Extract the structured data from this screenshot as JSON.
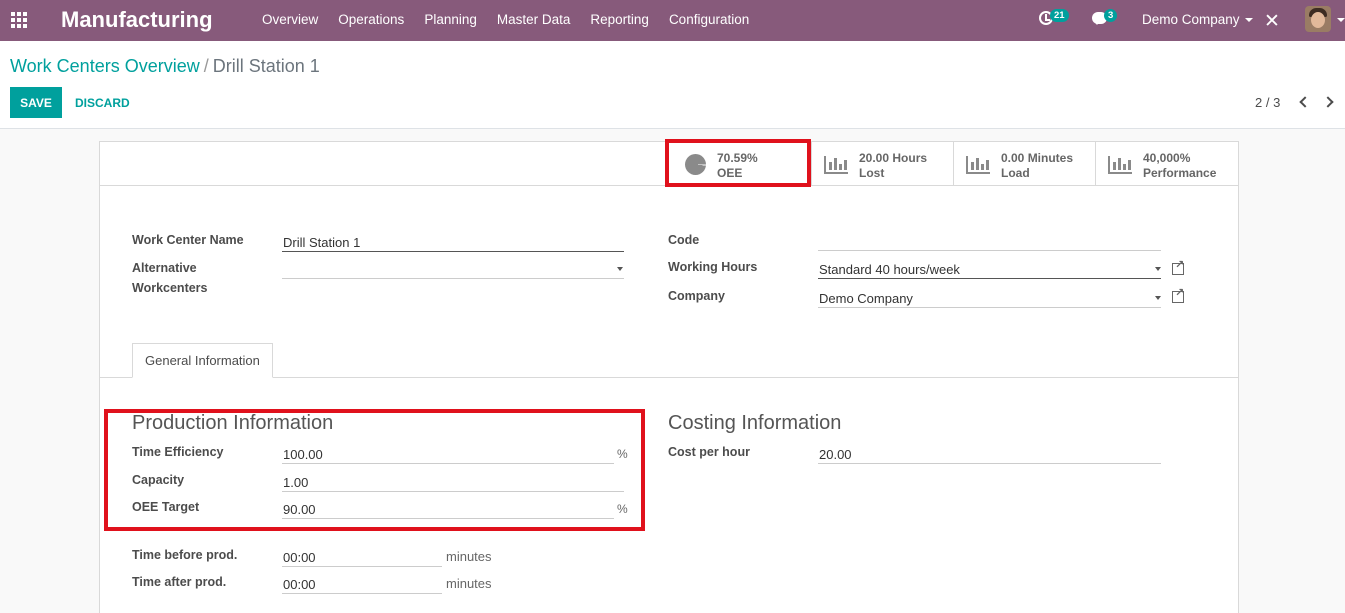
{
  "navbar": {
    "app_title": "Manufacturing",
    "menu": [
      "Overview",
      "Operations",
      "Planning",
      "Master Data",
      "Reporting",
      "Configuration"
    ],
    "activity_count": "21",
    "message_count": "3",
    "company": "Demo Company"
  },
  "breadcrumb": {
    "parent": "Work Centers Overview",
    "separator": "/",
    "current": "Drill Station 1"
  },
  "actions": {
    "save": "SAVE",
    "discard": "DISCARD"
  },
  "pager": {
    "value": "2 / 3"
  },
  "stat_buttons": [
    {
      "value": "70.59%",
      "label": "OEE",
      "icon": "pie-chart-icon"
    },
    {
      "value": "20.00 Hours",
      "label": "Lost",
      "icon": "bar-chart-icon"
    },
    {
      "value": "0.00 Minutes",
      "label": "Load",
      "icon": "bar-chart-icon"
    },
    {
      "value": "40,000%",
      "label": "Performance",
      "icon": "bar-chart-icon"
    }
  ],
  "form": {
    "work_center_name_label": "Work Center Name",
    "work_center_name_value": "Drill Station 1",
    "alternative_label": "Alternative Workcenters",
    "alternative_value": "",
    "code_label": "Code",
    "code_value": "",
    "working_hours_label": "Working Hours",
    "working_hours_value": "Standard 40 hours/week",
    "company_label": "Company",
    "company_value": "Demo Company"
  },
  "tabs": {
    "general": "General Information"
  },
  "production": {
    "title": "Production Information",
    "time_efficiency_label": "Time Efficiency",
    "time_efficiency_value": "100.00",
    "capacity_label": "Capacity",
    "capacity_value": "1.00",
    "oee_target_label": "OEE Target",
    "oee_target_value": "90.00",
    "percent_unit": "%",
    "time_before_label": "Time before prod.",
    "time_before_value": "00:00",
    "time_after_label": "Time after prod.",
    "time_after_value": "00:00",
    "minutes_unit": "minutes"
  },
  "costing": {
    "title": "Costing Information",
    "cost_per_hour_label": "Cost per hour",
    "cost_per_hour_value": "20.00"
  },
  "colors": {
    "brand": "#875a7b",
    "accent": "#00a09d",
    "highlight": "#e0111c"
  }
}
